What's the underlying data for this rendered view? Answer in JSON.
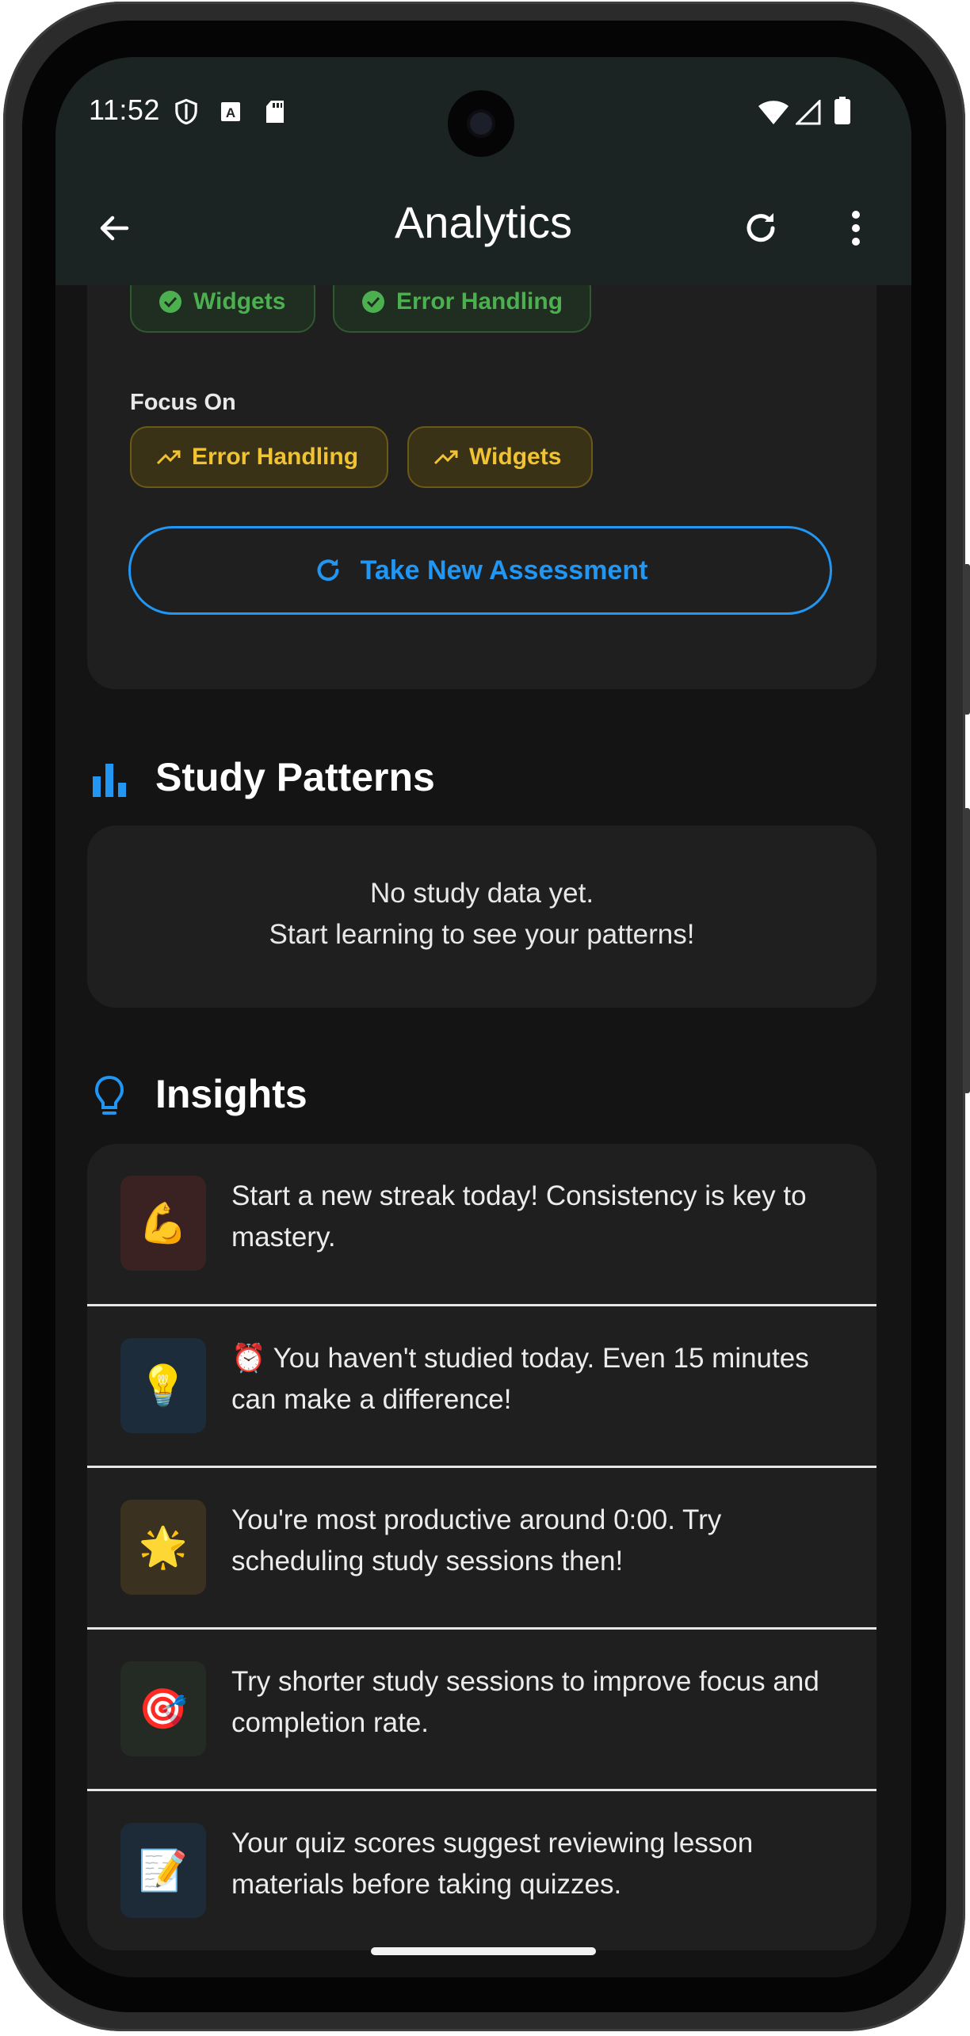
{
  "status_bar": {
    "time": "11:52",
    "icons": [
      "shield-icon",
      "a-icon",
      "sd-card-icon",
      "wifi-icon",
      "signal-icon",
      "battery-icon"
    ]
  },
  "app_bar": {
    "title": "Analytics",
    "back_icon": "arrow-left-icon",
    "refresh_icon": "refresh-icon",
    "menu_icon": "more-vert-icon"
  },
  "assessment_card": {
    "strengths": [
      "Widgets",
      "Error Handling"
    ],
    "focus_label": "Focus On",
    "focus_chips": [
      "Error Handling",
      "Widgets"
    ],
    "button_label": "Take New Assessment"
  },
  "study_patterns": {
    "heading": "Study Patterns",
    "empty_line1": "No study data yet.",
    "empty_line2": "Start learning to see your patterns!"
  },
  "insights": {
    "heading": "Insights",
    "items": [
      {
        "emoji": "💪",
        "text": "Start a new streak today! Consistency is key to mastery."
      },
      {
        "emoji": "💡",
        "text": "⏰ You haven't studied today. Even 15 minutes can make a difference!"
      },
      {
        "emoji": "🌟",
        "text": "You're most productive around 0:00. Try scheduling study sessions then!"
      },
      {
        "emoji": "🎯",
        "text": "Try shorter study sessions to improve focus and completion rate."
      },
      {
        "emoji": "📝",
        "text": "Your quiz scores suggest reviewing lesson materials before taking quizzes."
      }
    ]
  },
  "colors": {
    "accent_blue": "#2196f3",
    "success_green": "#4caf50",
    "warning_amber": "#f1c232",
    "app_bar_bg": "#1c2423",
    "card_bg": "#1f1f1f",
    "screen_bg": "#141414"
  }
}
